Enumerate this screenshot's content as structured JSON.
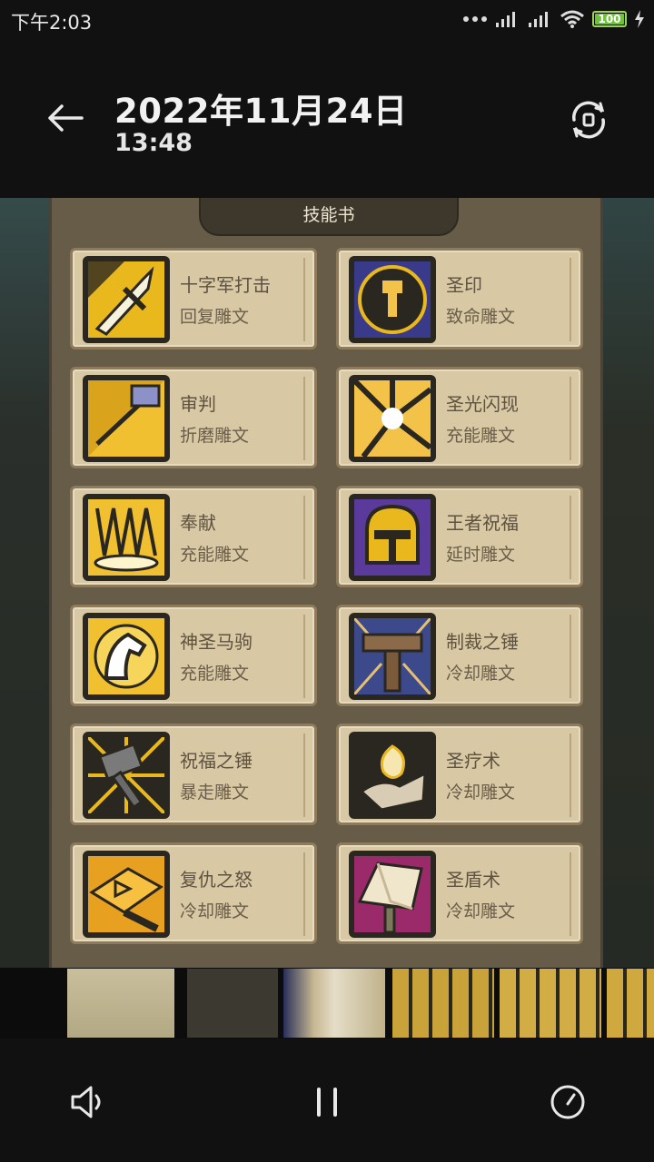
{
  "status_bar": {
    "time": "下午2:03",
    "battery": "100",
    "icons": [
      "more-dots-icon",
      "signal-icon",
      "signal-icon",
      "wifi-icon",
      "battery-icon",
      "charging-icon"
    ]
  },
  "header": {
    "date": "2022年11月24日",
    "time": "13:48",
    "back_icon": "back-arrow-icon",
    "rotate_icon": "rotate-icon"
  },
  "content": {
    "panel_title": "技能书",
    "skills": [
      {
        "name": "十字军打击",
        "rune": "回复雕文",
        "icon": "sword-strike-icon",
        "accent": "#e8b81c"
      },
      {
        "name": "圣印",
        "rune": "致命雕文",
        "icon": "holy-seal-icon",
        "accent": "#e8b81c"
      },
      {
        "name": "审判",
        "rune": "折磨雕文",
        "icon": "judgement-icon",
        "accent": "#e8b81c"
      },
      {
        "name": "圣光闪现",
        "rune": "充能雕文",
        "icon": "holy-flash-icon",
        "accent": "#f3c248"
      },
      {
        "name": "奉献",
        "rune": "充能雕文",
        "icon": "consecration-crown-icon",
        "accent": "#f0c030"
      },
      {
        "name": "王者祝福",
        "rune": "延时雕文",
        "icon": "kings-helmet-icon",
        "accent": "#e8b81c"
      },
      {
        "name": "神圣马驹",
        "rune": "充能雕文",
        "icon": "holy-steed-icon",
        "accent": "#f0c030"
      },
      {
        "name": "制裁之锤",
        "rune": "冷却雕文",
        "icon": "hammer-of-justice-icon",
        "accent": "#a07a50"
      },
      {
        "name": "祝福之锤",
        "rune": "暴走雕文",
        "icon": "blessed-hammer-icon",
        "accent": "#e8b81c"
      },
      {
        "name": "圣疗术",
        "rune": "冷却雕文",
        "icon": "lay-on-hands-icon",
        "accent": "#e6dcc8"
      },
      {
        "name": "复仇之怒",
        "rune": "冷却雕文",
        "icon": "avenging-wrath-icon",
        "accent": "#e8b81c"
      },
      {
        "name": "圣盾术",
        "rune": "冷却雕文",
        "icon": "divine-shield-icon",
        "accent": "#f0e6cc"
      }
    ]
  },
  "filmstrip": {
    "frames": [
      "frame-1",
      "frame-2",
      "frame-3",
      "frame-4",
      "frame-5",
      "frame-6"
    ]
  },
  "controls": {
    "volume_icon": "speaker-icon",
    "pause_icon": "pause-icon",
    "speed_icon": "speed-gauge-icon"
  }
}
